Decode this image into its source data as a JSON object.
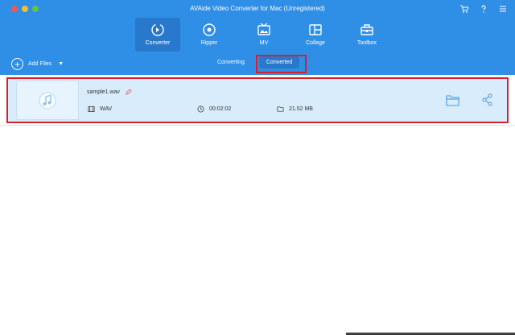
{
  "window": {
    "title": "AVAide Video Converter for Mac (Unregistered)",
    "icons": [
      "cart-icon",
      "help-icon",
      "menu-icon"
    ]
  },
  "nav": {
    "tabs": [
      {
        "label": "Converter",
        "icon": "converter-icon",
        "active": true
      },
      {
        "label": "Ripper",
        "icon": "ripper-icon",
        "active": false
      },
      {
        "label": "MV",
        "icon": "mv-icon",
        "active": false
      },
      {
        "label": "Collage",
        "icon": "collage-icon",
        "active": false
      },
      {
        "label": "Toolbox",
        "icon": "toolbox-icon",
        "active": false
      }
    ]
  },
  "toolbar": {
    "add_files_label": "Add Files",
    "segments": [
      {
        "label": "Converting",
        "active": false
      },
      {
        "label": "Converted",
        "active": true
      }
    ]
  },
  "files": [
    {
      "name": "sample1.wav",
      "format": "WAV",
      "duration": "00:02:02",
      "size": "21.52 MB"
    }
  ],
  "colors": {
    "header": "#2f8ee6",
    "active_tab": "#2879cc",
    "row": "#d8ecfb",
    "highlight": "#d8202d"
  }
}
